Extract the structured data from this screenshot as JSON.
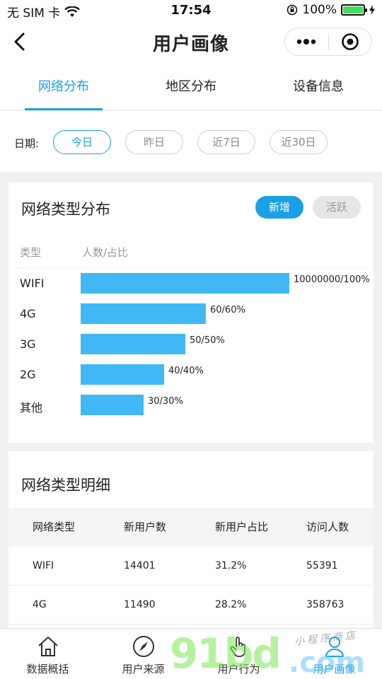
{
  "status_bar": {
    "carrier": "无 SIM 卡",
    "time": "17:54",
    "battery": "100%"
  },
  "nav": {
    "title": "用户画像"
  },
  "tabs": [
    {
      "label": "网络分布",
      "active": true
    },
    {
      "label": "地区分布",
      "active": false
    },
    {
      "label": "设备信息",
      "active": false
    }
  ],
  "date_filter": {
    "label": "日期:",
    "options": [
      {
        "label": "今日",
        "active": true
      },
      {
        "label": "昨日",
        "active": false
      },
      {
        "label": "近7日",
        "active": false
      },
      {
        "label": "近30日",
        "active": false
      }
    ]
  },
  "network_distribution": {
    "title": "网络类型分布",
    "toggle_new": "新增",
    "toggle_active": "活跃",
    "header_type": "类型",
    "header_count": "人数/占比",
    "rows": [
      {
        "name": "WIFI",
        "label": "10000000/100%",
        "percent": 100
      },
      {
        "name": "4G",
        "label": "60/60%",
        "percent": 60
      },
      {
        "name": "3G",
        "label": "50/50%",
        "percent": 50
      },
      {
        "name": "2G",
        "label": "40/40%",
        "percent": 40
      },
      {
        "name": "其他",
        "label": "30/30%",
        "percent": 30
      }
    ]
  },
  "network_detail": {
    "title": "网络类型明细",
    "columns": [
      "网络类型",
      "新用户数",
      "新用户占比",
      "访问人数"
    ],
    "rows": [
      [
        "WIFI",
        "14401",
        "31.2%",
        "55391"
      ],
      [
        "4G",
        "11490",
        "28.2%",
        "358763"
      ]
    ]
  },
  "tab_bar": [
    {
      "label": "数据概括",
      "icon": "home-icon",
      "active": false
    },
    {
      "label": "用户来源",
      "icon": "compass-icon",
      "active": false
    },
    {
      "label": "用户行为",
      "icon": "hand-pointer-icon",
      "active": false
    },
    {
      "label": "用户画像",
      "icon": "user-icon",
      "active": true
    }
  ],
  "watermark": {
    "brand": "91bd",
    "domain": ".com",
    "tagline": "小程序商店"
  },
  "colors": {
    "accent": "#1aa0e6",
    "bar": "#3fb8f5"
  }
}
